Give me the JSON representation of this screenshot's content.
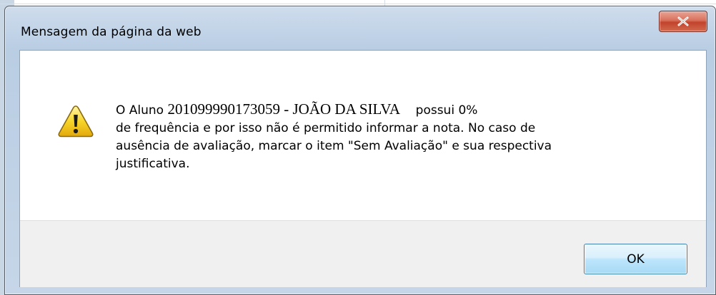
{
  "dialog": {
    "title": "Mensagem da página da web",
    "close_icon": "close-x-icon",
    "message": {
      "prefix": "O Aluno ",
      "student": "201099990173059 - JOÃO DA SILVA",
      "after_student": "possui 0%",
      "line2": "de frequência e por isso não é permitido informar a nota. No caso de",
      "line3": "ausência de avaliação, marcar o item \"Sem Avaliação\" e sua respectiva",
      "line4": "justificativa."
    },
    "warning_icon": "warning-triangle-icon",
    "ok_label": "OK"
  }
}
